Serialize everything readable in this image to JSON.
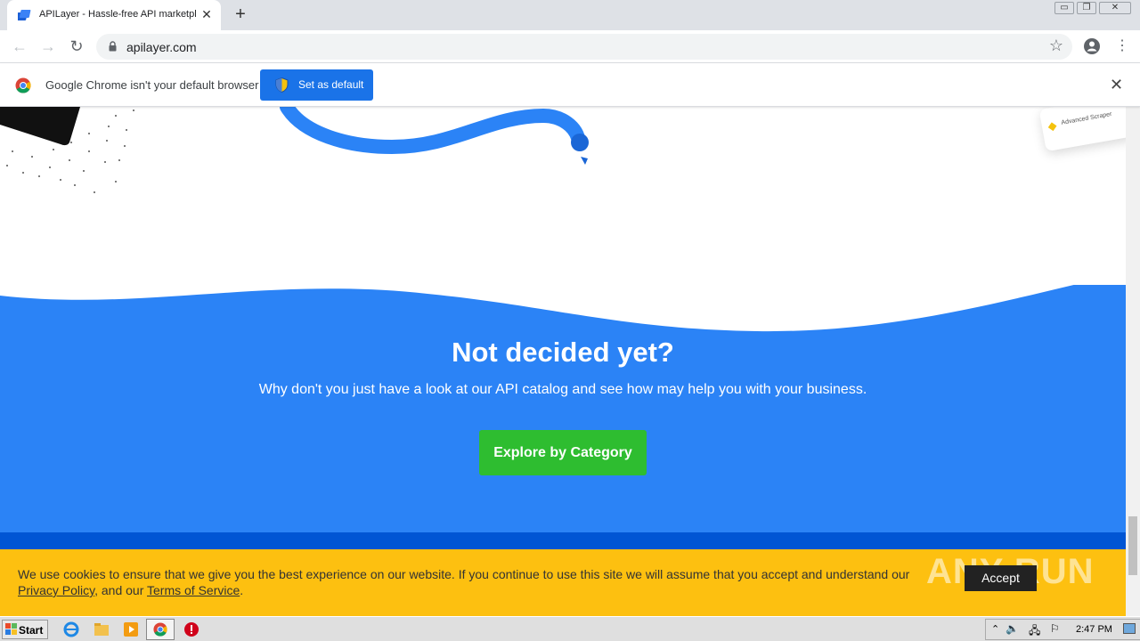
{
  "browser": {
    "tab_title": "APILayer - Hassle-free API marketplace",
    "tab_close": "✕",
    "new_tab": "+",
    "url": "apilayer.com",
    "window_controls": [
      "▭",
      "❐",
      "✕"
    ]
  },
  "infobar": {
    "message": "Google Chrome isn't your default browser",
    "button_label": "Set as default",
    "close": "✕"
  },
  "page": {
    "headline": "Not decided yet?",
    "subline": "Why don't you just have a look at our API catalog and see how may help you with your business.",
    "cta_label": "Explore by Category",
    "colors": {
      "primary_blue": "#2b83f6",
      "cta_green": "#2ebd30",
      "footer_blue": "#0055d4"
    },
    "corner_card_label": "Advanced Scraper"
  },
  "cookie_banner": {
    "text_prefix": "We use cookies to ensure that we give you the best experience on our website. If you continue to use this site we will assume that you accept and understand our ",
    "privacy_link": "Privacy Policy",
    "middle": ", and our ",
    "terms_link": "Terms of Service",
    "suffix": ".",
    "accept_label": "Accept",
    "watermark": "ANY RUN"
  },
  "taskbar": {
    "start_label": "Start",
    "clock": "2:47 PM"
  }
}
